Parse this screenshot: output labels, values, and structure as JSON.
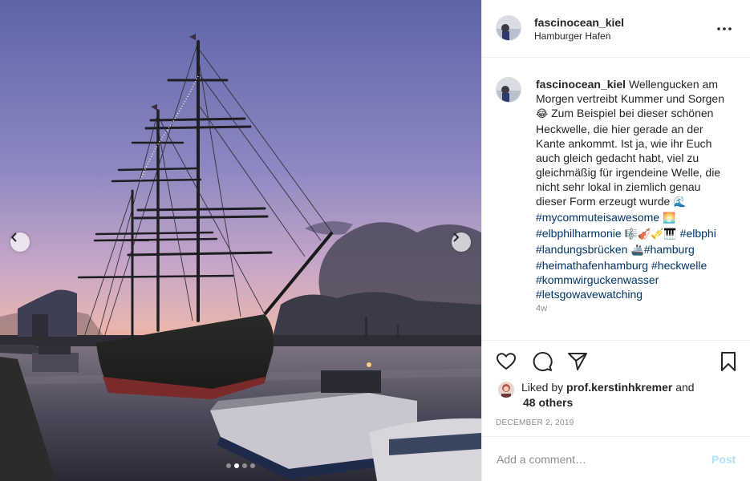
{
  "post": {
    "username": "fascinocean_kiel",
    "location": "Hamburger Hafen",
    "caption_user": "fascinocean_kiel",
    "caption_lines": {
      "l1": "Wellengucken am",
      "l2": "Morgen vertreibt Kummer und Sorgen",
      "l3_emoji": "😂",
      "l3": " Zum Beispiel bei dieser schönen",
      "l4": "Heckwelle, die hier gerade an der",
      "l5": "Kante ankommt. Ist ja, wie ihr Euch",
      "l6": "auch gleich gedacht habt, viel zu",
      "l7": "gleichmäßig für irgendeine Welle, die",
      "l8": "nicht sehr lokal in ziemlich genau",
      "l9": "dieser Form erzeugt wurde ",
      "l9_emoji": "🌊"
    },
    "hashtags": {
      "mycommute": "#mycommuteisawesome",
      "mycommute_emoji": " 🌅",
      "elbphilharmonie": "#elbphilharmonie",
      "elbphilharmonie_emoji": " 🎼🎻🎺🎹 ",
      "elbphi": "#elbphi",
      "landungsbruecken": "#landungsbrücken",
      "landungsbruecken_emoji": " 🚢",
      "hamburg": "#hamburg",
      "heimathafen": "#heimathafenhamburg",
      "heckwelle": "#heckwelle",
      "kommwir": "#kommwirguckenwasser",
      "letsgo": "#letsgowavewatching"
    },
    "time_ago": "4w",
    "liked_by_prefix": "Liked by ",
    "liked_by_user": "prof.kerstinhkremer",
    "liked_by_and": " and",
    "liked_by_others": "48 others",
    "date": "DECEMBER 2, 2019",
    "comment_placeholder": "Add a comment…",
    "post_label": "Post"
  },
  "carousel": {
    "slides": 4,
    "active_slide": 2
  },
  "icons": {
    "more": "more-options-icon",
    "like": "heart-icon",
    "comment": "comment-icon",
    "share": "share-icon",
    "save": "bookmark-icon",
    "prev": "chevron-left-icon",
    "next": "chevron-right-icon"
  }
}
